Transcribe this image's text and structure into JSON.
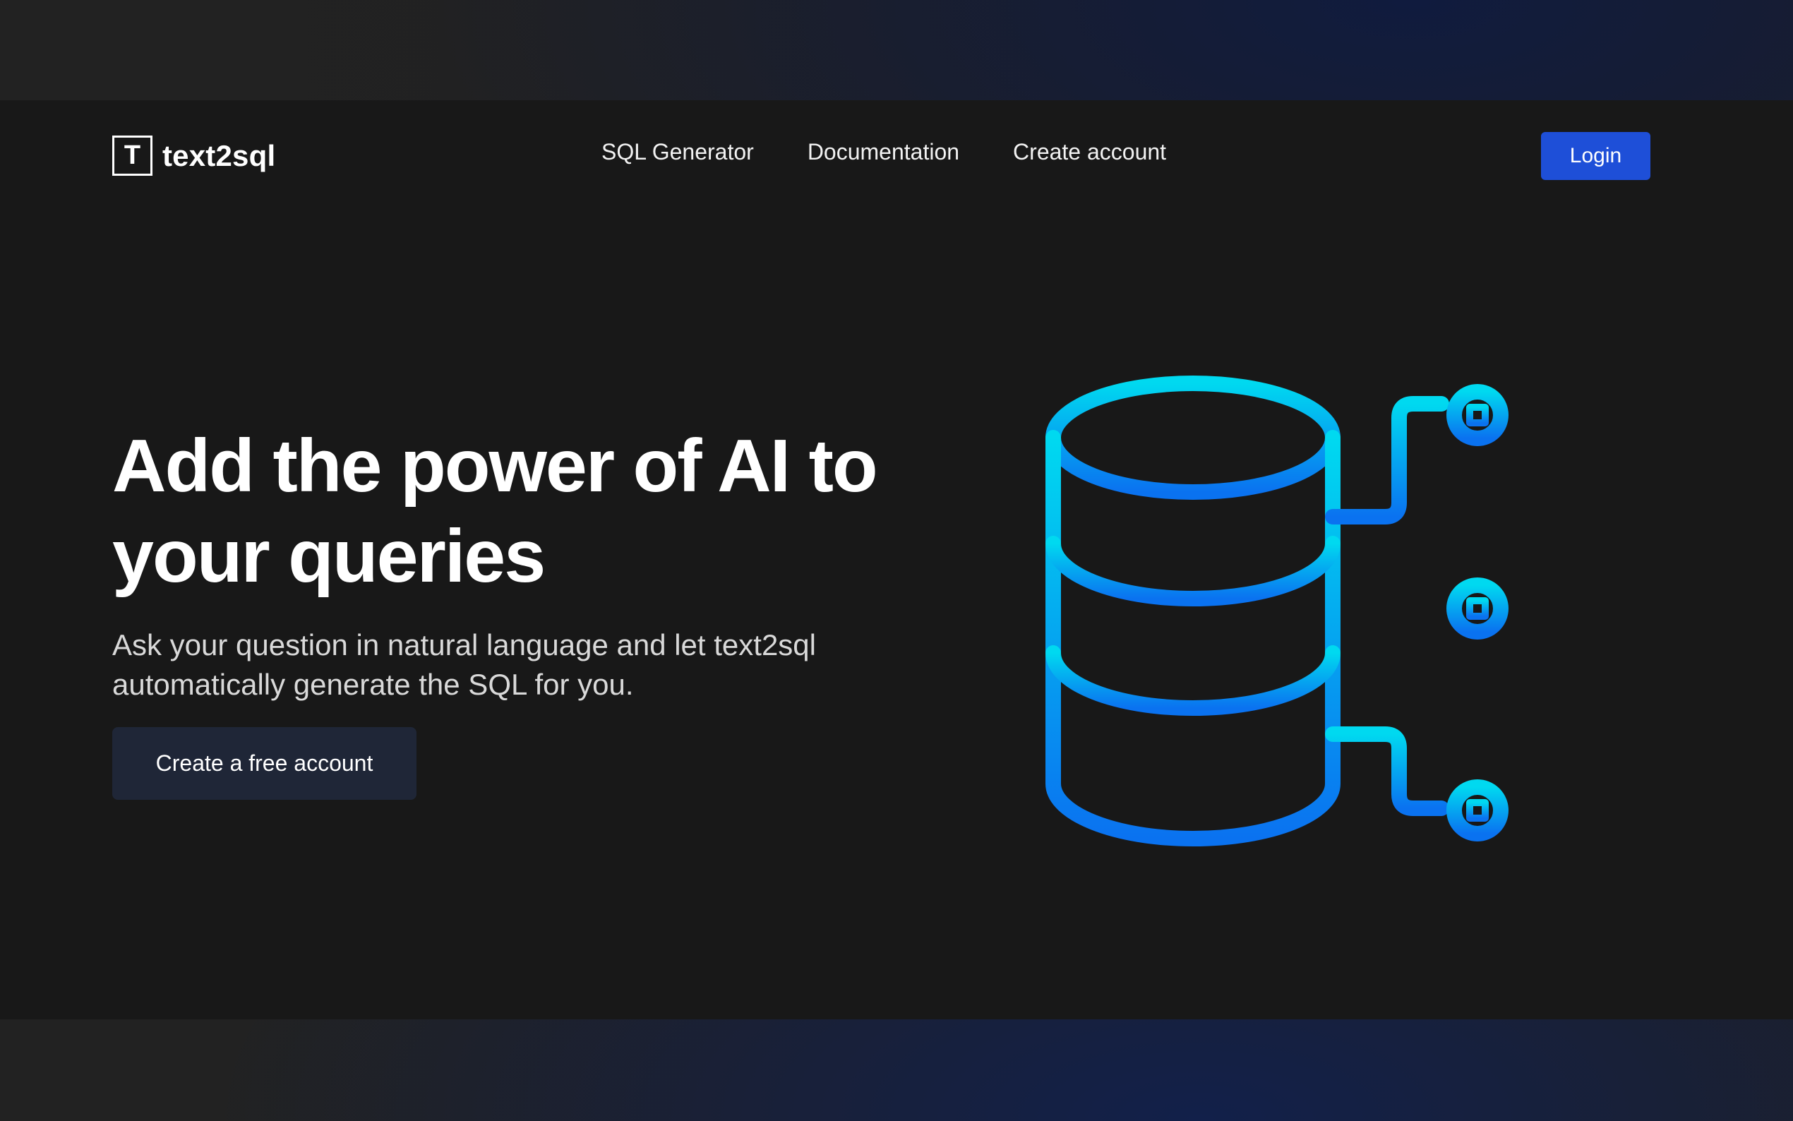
{
  "brand": {
    "logo_letter": "T",
    "name": "text2sql"
  },
  "nav": {
    "links": [
      "SQL Generator",
      "Documentation",
      "Create account"
    ],
    "login_label": "Login"
  },
  "hero": {
    "title_line1": "Add the power of AI to",
    "title_line2": "your queries",
    "subtitle_line1": "Ask your question in natural language and let text2sql",
    "subtitle_line2": "automatically generate the SQL for you.",
    "cta_label": "Create a free account"
  },
  "illustration": {
    "icon": "database-network-icon"
  },
  "colors": {
    "accent": "#1e4fd8",
    "gradient_top": "#00d9f0",
    "gradient_bottom": "#0a72f0",
    "frame_bg": "#181818",
    "cta_bg": "#1f2637"
  }
}
